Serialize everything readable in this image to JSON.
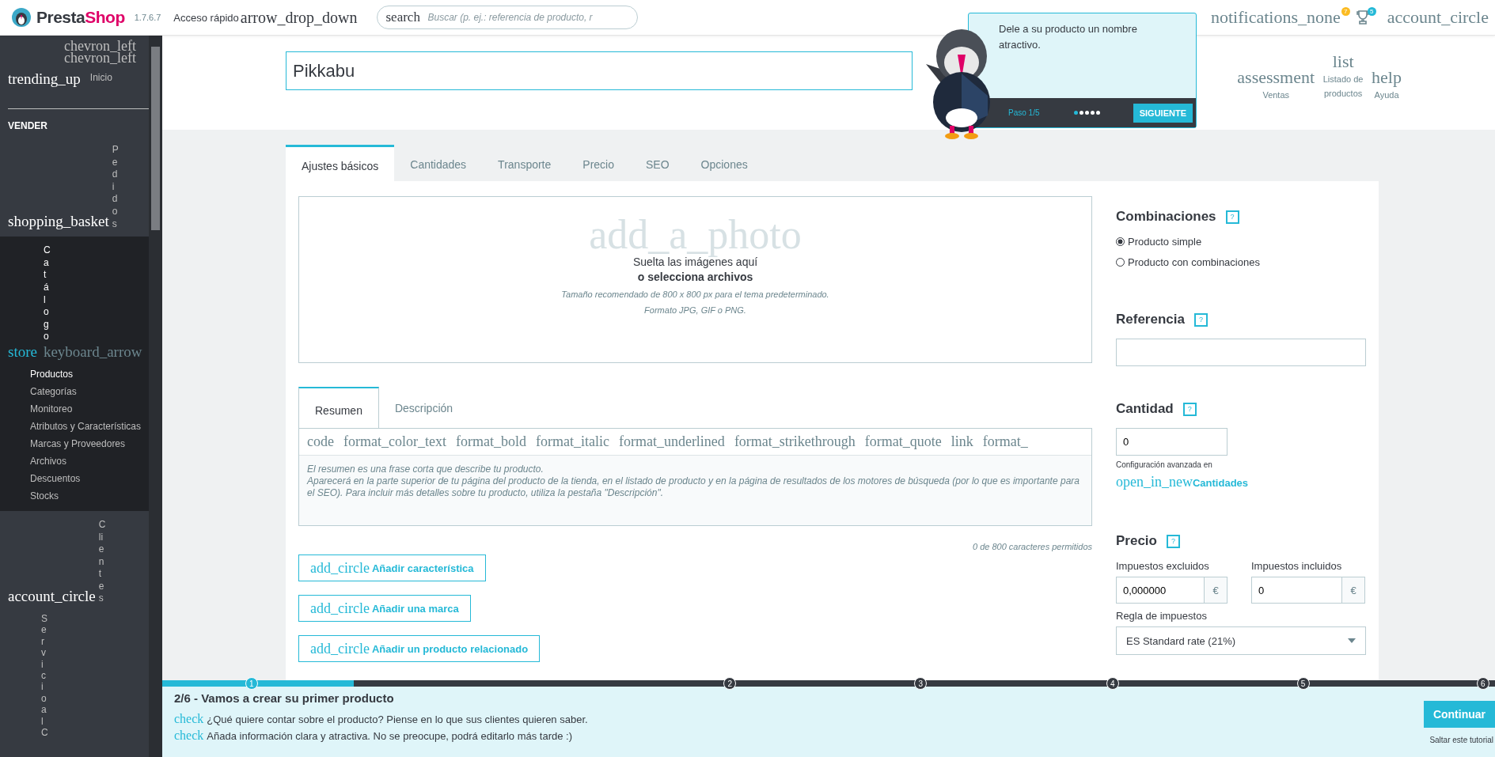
{
  "topbar": {
    "brand": [
      "Presta",
      "Shop"
    ],
    "version": "1.7.6.7",
    "quick_access": {
      "label": "Acceso rápido",
      "icon": "arrow_drop_down"
    },
    "search": {
      "icon": "search",
      "placeholder": "Buscar (p. ej.: referencia de producto, r"
    },
    "notifications": {
      "icon": "notifications_none",
      "badge": "7"
    },
    "trophy_badge": "5",
    "account": "account_circle"
  },
  "sidebar": {
    "collapse": [
      "chevron_left",
      "chevron_left"
    ],
    "home": {
      "icon": "trending_up",
      "label": "Inicio"
    },
    "section": "VENDER",
    "items": [
      {
        "icon": "shopping_basket",
        "label": "Pedidos",
        "selected": false
      },
      {
        "icon": "store",
        "label": "Catálogo",
        "selected": true,
        "arrow": "keyboard_arrow",
        "children": [
          {
            "label": "Productos",
            "selected": true
          },
          {
            "label": "Categorías",
            "selected": false
          },
          {
            "label": "Monitoreo",
            "selected": false
          },
          {
            "label": "Atributos y Características",
            "selected": false
          },
          {
            "label": "Marcas y Proveedores",
            "selected": false
          },
          {
            "label": "Archivos",
            "selected": false
          },
          {
            "label": "Descuentos",
            "selected": false
          },
          {
            "label": "Stocks",
            "selected": false
          }
        ]
      },
      {
        "icon": "account_circle",
        "label": "Clientes",
        "selected": false
      },
      {
        "label": "Servicio al C",
        "selected": false
      }
    ]
  },
  "header": {
    "product_name": "Pikkabu",
    "actions": [
      {
        "icon": "assessment",
        "label": "Ventas"
      },
      {
        "icon": "list",
        "label": "Listado de productos"
      },
      {
        "icon": "help",
        "label": "Ayuda"
      }
    ]
  },
  "tutorial_popup": {
    "text": "Dele a su producto un nombre atractivo.",
    "step": "Paso 1/5",
    "dots": [
      {
        "selected": true
      },
      {
        "selected": false
      },
      {
        "selected": false
      },
      {
        "selected": false
      },
      {
        "selected": false
      }
    ],
    "button": "SIGUIENTE"
  },
  "tabs": [
    {
      "label": "Ajustes básicos",
      "selected": true
    },
    {
      "label": "Cantidades",
      "selected": false
    },
    {
      "label": "Transporte",
      "selected": false
    },
    {
      "label": "Precio",
      "selected": false
    },
    {
      "label": "SEO",
      "selected": false
    },
    {
      "label": "Opciones",
      "selected": false
    }
  ],
  "dropzone": {
    "icon": "add_a_photo",
    "title": "Suelta las imágenes aquí",
    "link": "o selecciona archivos",
    "hints": [
      "Tamaño recomendado de 800 x 800 px para el tema predeterminado.",
      "Formato JPG, GIF o PNG."
    ]
  },
  "summary": {
    "tabs": [
      {
        "label": "Resumen",
        "selected": true
      },
      {
        "label": "Descripción",
        "selected": false
      }
    ],
    "toolbar": [
      "code",
      "format_color_text",
      "format_bold",
      "format_italic",
      "format_underlined",
      "format_strikethrough",
      "format_quote",
      "link",
      "format_"
    ],
    "placeholder": "El resumen es una frase corta que describe tu producto.\nAparecerá en la parte superior de tu página del producto de la tienda, en el listado de producto y en la página de resultados de los motores de búsqueda (por lo que es importante para el SEO). Para incluir más detalles sobre tu producto, utiliza la pestaña \"Descripción\".",
    "counter": "0 de 800 caracteres permitidos"
  },
  "add_buttons": [
    {
      "icon": "add_circle",
      "label": "Añadir característica"
    },
    {
      "icon": "add_circle",
      "label": "Añadir una marca"
    },
    {
      "icon": "add_circle",
      "label": "Añadir un producto relacionado"
    }
  ],
  "combinations": {
    "title": "Combinaciones",
    "help": "?",
    "options": [
      {
        "label": "Producto simple",
        "selected": true
      },
      {
        "label": "Producto con combinaciones",
        "selected": false
      }
    ]
  },
  "reference": {
    "title": "Referencia",
    "help": "?"
  },
  "quantity": {
    "title": "Cantidad",
    "help": "?",
    "value": "0",
    "note": "Configuración avanzada en",
    "link_icon": "open_in_new",
    "link": "Cantidades"
  },
  "price": {
    "title": "Precio",
    "help": "?",
    "fields": [
      {
        "label": "Impuestos excluidos",
        "value": "0,000000",
        "currency": "€"
      },
      {
        "label": "Impuestos incluidos",
        "value": "0",
        "currency": "€"
      }
    ],
    "tax_label": "Regla de impuestos",
    "tax_value": "ES Standard rate (21%)"
  },
  "tour": {
    "level": 0.144,
    "steps": [
      {
        "label": "1",
        "done": true
      },
      {
        "label": "2",
        "done": false
      },
      {
        "label": "3",
        "done": false
      },
      {
        "label": "4",
        "done": false
      },
      {
        "label": "5",
        "done": false
      },
      {
        "label": "6",
        "done": false
      }
    ],
    "title": "2/6 - Vamos a crear su primer producto",
    "checks": [
      {
        "icon": "check",
        "text": "¿Qué quiere contar sobre el producto? Piense en lo que sus clientes quieren saber."
      },
      {
        "icon": "check",
        "text": "Añada información clara y atractiva. No se preocupe, podrá editarlo más tarde :)"
      }
    ],
    "button": "Continuar",
    "skip": "Saltar este tutorial"
  }
}
